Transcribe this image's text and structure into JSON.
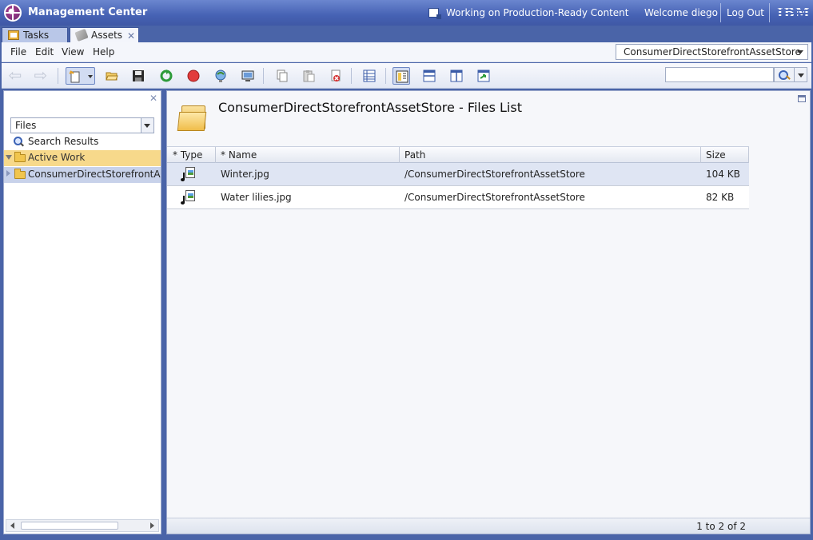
{
  "app": {
    "title": "Management Center"
  },
  "header": {
    "working_on": "Working on Production-Ready Content",
    "welcome": "Welcome diego",
    "logout": "Log Out",
    "brand": "IBM"
  },
  "tabs": [
    {
      "label": "Tasks",
      "icon": "tasks-icon",
      "active": false
    },
    {
      "label": "Assets",
      "icon": "assets-icon",
      "active": true
    }
  ],
  "menu": {
    "items": [
      "File",
      "Edit",
      "View",
      "Help"
    ],
    "store_selector": "ConsumerDirectStorefrontAssetStore"
  },
  "toolbar": {
    "buttons": [
      "back-icon",
      "forward-icon",
      "new-icon",
      "open-icon",
      "save-icon",
      "refresh-icon",
      "stop-icon",
      "preview-icon",
      "display-icon",
      "copy-icon",
      "paste-icon",
      "delete-icon",
      "list-view-icon",
      "list-properties-view-icon",
      "split-horizontal-icon",
      "split-vertical-icon",
      "change-view-icon"
    ],
    "search_value": ""
  },
  "explorer": {
    "filter_value": "Files",
    "items": [
      {
        "label": "Search Results",
        "icon": "search-icon"
      },
      {
        "label": "Active Work",
        "icon": "folder-icon"
      },
      {
        "label": "ConsumerDirectStorefrontAssetStore",
        "icon": "folder-icon"
      }
    ]
  },
  "main": {
    "title": "ConsumerDirectStorefrontAssetStore - Files List",
    "columns": [
      "* Type",
      "* Name",
      "Path",
      "Size"
    ],
    "rows": [
      {
        "type_icon": "file-icon",
        "name": "Winter.jpg",
        "path": "/ConsumerDirectStorefrontAssetStore",
        "size": "104 KB",
        "selected": true
      },
      {
        "type_icon": "file-icon",
        "name": "Water lilies.jpg",
        "path": "/ConsumerDirectStorefrontAssetStore",
        "size": "82 KB",
        "selected": false
      }
    ],
    "pagination": "1 to 2 of 2"
  },
  "colors": {
    "accent": "#4a64a8",
    "selection": "#dfe5f3",
    "active_work": "#f7d98b"
  }
}
